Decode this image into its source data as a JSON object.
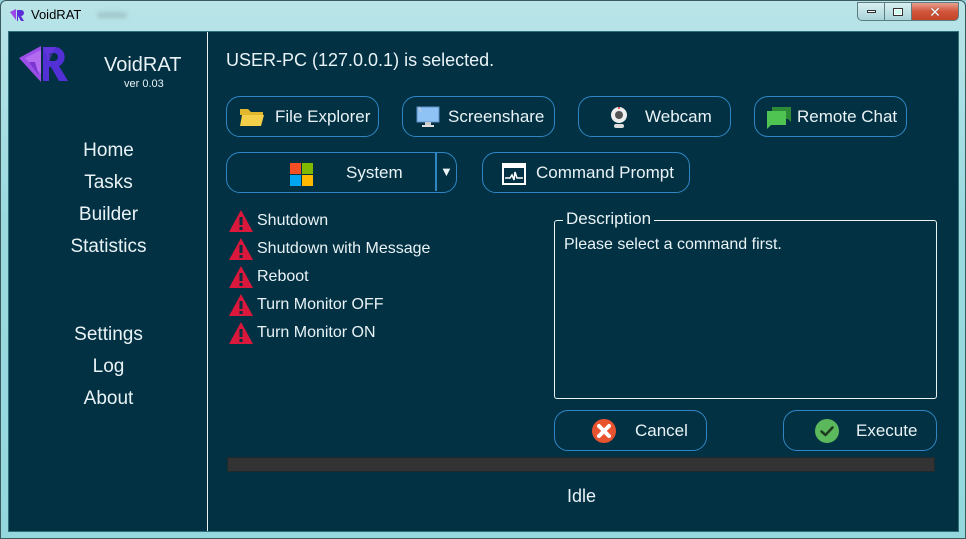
{
  "window": {
    "title": "VoidRAT",
    "controls": {
      "minimize": "minimize",
      "maximize": "maximize",
      "close": "close"
    }
  },
  "sidebar": {
    "brand": {
      "name": "VoidRAT",
      "version": "ver 0.03"
    },
    "nav_top": [
      {
        "label": "Home"
      },
      {
        "label": "Tasks"
      },
      {
        "label": "Builder"
      },
      {
        "label": "Statistics"
      }
    ],
    "nav_bottom": [
      {
        "label": "Settings"
      },
      {
        "label": "Log"
      },
      {
        "label": "About"
      }
    ]
  },
  "main": {
    "selected_text": "USER-PC (127.0.0.1) is selected.",
    "toolbar": {
      "file_explorer": {
        "label": "File Explorer",
        "icon": "folder-icon"
      },
      "screenshare": {
        "label": "Screenshare",
        "icon": "monitor-icon"
      },
      "webcam": {
        "label": "Webcam",
        "icon": "webcam-icon"
      },
      "remote_chat": {
        "label": "Remote Chat",
        "icon": "chat-icon"
      },
      "system": {
        "label": "System",
        "icon": "windows-icon",
        "dropdown_glyph": "▼"
      },
      "command_prompt": {
        "label": "Command Prompt",
        "icon": "terminal-icon"
      }
    },
    "commands": [
      {
        "label": "Shutdown",
        "icon": "warning-icon"
      },
      {
        "label": "Shutdown with Message",
        "icon": "warning-icon"
      },
      {
        "label": "Reboot",
        "icon": "warning-icon"
      },
      {
        "label": "Turn Monitor OFF",
        "icon": "warning-icon"
      },
      {
        "label": "Turn Monitor ON",
        "icon": "warning-icon"
      }
    ],
    "description": {
      "legend": "Description",
      "text": "Please select a command first."
    },
    "actions": {
      "cancel": {
        "label": "Cancel",
        "icon": "cancel-icon"
      },
      "execute": {
        "label": "Execute",
        "icon": "check-icon"
      }
    },
    "progress": {
      "value_percent": 0
    },
    "status": "Idle"
  },
  "colors": {
    "background": "#023143",
    "accent_border": "#2f86c4",
    "text": "#e9f3f6",
    "warning": "#d9183b",
    "cancel": "#e8542f",
    "execute": "#5cb85c"
  }
}
